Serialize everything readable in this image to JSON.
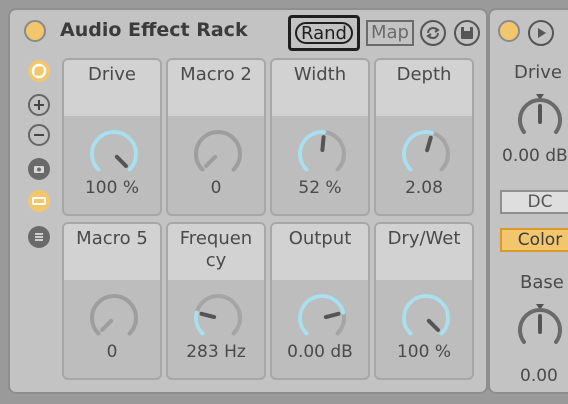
{
  "rack": {
    "title": "Audio Effect Rack",
    "rand_label": "Rand",
    "map_label": "Map",
    "colors": {
      "power_on": "#f2c66d",
      "knob_active": "#a9dfee",
      "knob_inactive": "#9e9e9e"
    },
    "side_buttons": [
      "chain-icon",
      "plus-icon",
      "minus-icon",
      "camera-icon",
      "macro-toggle-icon",
      "list-icon"
    ],
    "macros": [
      {
        "label": "Drive",
        "value": "100 %",
        "level": 1.0
      },
      {
        "label": "Macro 2",
        "value": "0",
        "level": 0.0
      },
      {
        "label": "Width",
        "value": "52 %",
        "level": 0.52
      },
      {
        "label": "Depth",
        "value": "2.08",
        "level": 0.56
      },
      {
        "label": "Macro 5",
        "value": "0",
        "level": 0.0
      },
      {
        "label": "Frequen cy",
        "value": "283 Hz",
        "level": 0.22
      },
      {
        "label": "Output",
        "value": "0.00 dB",
        "level": 0.78
      },
      {
        "label": "Dry/Wet",
        "value": "100 %",
        "level": 1.0
      }
    ]
  },
  "device2": {
    "drive_label": "Drive",
    "drive_value": "0.00 dB",
    "dc_label": "DC",
    "color_label": "Color",
    "base_label": "Base",
    "base_value": "0.00"
  }
}
